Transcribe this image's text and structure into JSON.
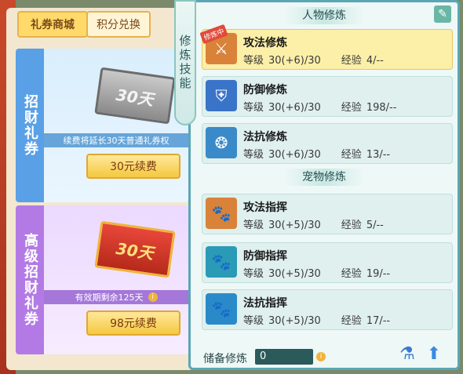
{
  "tabs": {
    "mall": "礼券商城",
    "points": "积分兑换"
  },
  "card1": {
    "title": "招财礼券",
    "ticket_text": "30天",
    "info": "续费将延长30天普通礼券权",
    "button": "30元续费"
  },
  "card2": {
    "title": "高级招财礼券",
    "ticket_text": "30天",
    "info": "有效期剩余125天",
    "button": "98元续费"
  },
  "side_label": "修炼技能",
  "sections": {
    "character": "人物修炼",
    "pet": "宠物修炼"
  },
  "badge": "修炼中",
  "skills": [
    {
      "name": "攻法修炼",
      "level_label": "等级",
      "level": "30(+6)/30",
      "exp_label": "经验",
      "exp": "4/--",
      "icon": "attack-cultivation-icon",
      "color": "#d9823a"
    },
    {
      "name": "防御修炼",
      "level_label": "等级",
      "level": "30(+6)/30",
      "exp_label": "经验",
      "exp": "198/--",
      "icon": "defense-cultivation-icon",
      "color": "#3a74c9"
    },
    {
      "name": "法抗修炼",
      "level_label": "等级",
      "level": "30(+6)/30",
      "exp_label": "经验",
      "exp": "13/--",
      "icon": "magic-resist-cultivation-icon",
      "color": "#3a8ac9"
    }
  ],
  "pet_skills": [
    {
      "name": "攻法指挥",
      "level_label": "等级",
      "level": "30(+5)/30",
      "exp_label": "经验",
      "exp": "5/--",
      "icon": "pet-attack-icon",
      "color": "#d9823a"
    },
    {
      "name": "防御指挥",
      "level_label": "等级",
      "level": "30(+5)/30",
      "exp_label": "经验",
      "exp": "19/--",
      "icon": "pet-defense-icon",
      "color": "#2a9ab6"
    },
    {
      "name": "法抗指挥",
      "level_label": "等级",
      "level": "30(+5)/30",
      "exp_label": "经验",
      "exp": "17/--",
      "icon": "pet-magic-resist-icon",
      "color": "#2a8ac9"
    }
  ],
  "reserve": {
    "label": "储备修炼",
    "value": "0"
  }
}
